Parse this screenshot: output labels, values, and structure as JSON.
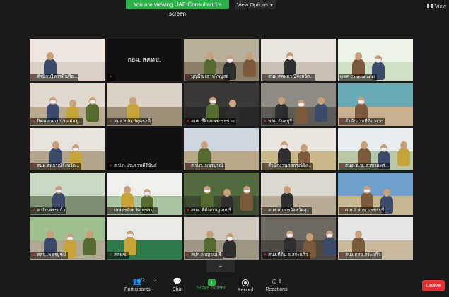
{
  "banner": {
    "viewing_text": "You are viewing UAE Consultant1's screen"
  },
  "view_options": {
    "label": "View Options"
  },
  "view_button": {
    "label": "View"
  },
  "tiles": [
    {
      "name": "สำนักบริหารพื้นที่อ...",
      "kind": "photo"
    },
    {
      "name": "",
      "center": "กยผ. สคทช.",
      "kind": "blank"
    },
    {
      "name": "บุญยืน เลาหไพบูลย์",
      "kind": "photo"
    },
    {
      "name": "สนผ.สคทกรณีจังหวัด...",
      "kind": "photo"
    },
    {
      "name": "UAE Consultant1",
      "kind": "photo",
      "active": true
    },
    {
      "name": "นิคม สหกรณ์ฯ แม่สรุ...",
      "kind": "photo"
    },
    {
      "name": "สนง.สปก.ปทุมธานี",
      "kind": "photo"
    },
    {
      "name": "สนผ.ที่ดินแพรกระชาย",
      "kind": "photo"
    },
    {
      "name": "ทสจ.จันทบุรี",
      "kind": "photo"
    },
    {
      "name": "สำนักงานที่ดิน ตาก",
      "kind": "photo"
    },
    {
      "name": "สนผ.สหกรณ์จังหวัด...",
      "kind": "photo"
    },
    {
      "name": "ส.ป.ก.ประจวบคีรีขันธ์",
      "kind": "blank"
    },
    {
      "name": "ส.ป.ก.เพชรบุรณ์",
      "kind": "photo"
    },
    {
      "name": "สำนักงานสหกรณ์จัง...",
      "kind": "photo"
    },
    {
      "name": "สนง. อ.ช. สาขาแพร่...",
      "kind": "photo"
    },
    {
      "name": "ส.ป.ก.สระแก้ว",
      "kind": "photo"
    },
    {
      "name": "เกษตรจังหวัดเพชรบุ...",
      "kind": "photo"
    },
    {
      "name": "สนง. ที่ดินกาญจนบุรี",
      "kind": "photo"
    },
    {
      "name": "สนง.เกษตรจังหวัดสุ...",
      "kind": "photo"
    },
    {
      "name": "ศ.ภ.2 สาขาเพชรบุรี",
      "kind": "photo"
    },
    {
      "name": "ทสจ.เพชรบูรณ์",
      "kind": "photo"
    },
    {
      "name": "สคทช.",
      "kind": "photo"
    },
    {
      "name": "สปก.กาญจนบุรี",
      "kind": "photo"
    },
    {
      "name": "สนง.ที่ดิน จ.สระแก้ว",
      "kind": "photo"
    },
    {
      "name": "สนง.ทสจ.สระแก้ว",
      "kind": "photo"
    }
  ],
  "toolbar": {
    "participants_label": "Participants",
    "participants_count": "72",
    "chat_label": "Chat",
    "share_label": "Share Screen",
    "record_label": "Record",
    "reactions_label": "Reactions",
    "leave_label": "Leave"
  },
  "colors": {
    "share_green": "#2bb04a",
    "leave_red": "#d33333",
    "active_outline": "#b9d634"
  }
}
